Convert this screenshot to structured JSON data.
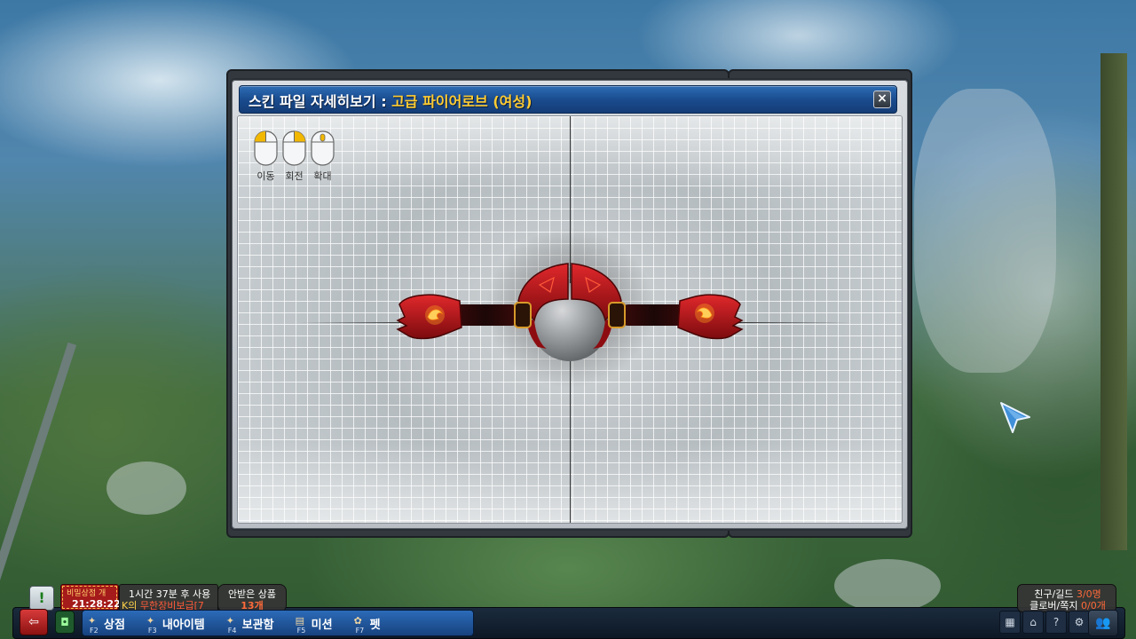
{
  "dialog": {
    "title_prefix": "스킨 파일 자세히보기 : ",
    "item_name": "고급 파이어로브 (여성)",
    "close_symbol": "×",
    "mouse_controls": [
      {
        "label": "이동",
        "button": "left"
      },
      {
        "label": "회전",
        "button": "right"
      },
      {
        "label": "확대",
        "button": "wheel"
      }
    ]
  },
  "hud": {
    "alert_symbol": "!",
    "notices": {
      "secret_shop": {
        "title": "비밀상점 개",
        "time": "21:28:22"
      },
      "buff": {
        "line1": "1시간 37분 후 사용",
        "line2_prefix": "K의 ",
        "line2_highlight": "무한장비보급[7"
      },
      "gifts": {
        "line1": "안받은 상품",
        "line2": "13개"
      }
    },
    "menu": [
      {
        "key": "F2",
        "label": "상점"
      },
      {
        "key": "F3",
        "label": "내아이템"
      },
      {
        "key": "F4",
        "label": "보관함"
      },
      {
        "key": "F5",
        "label": "미션"
      },
      {
        "key": "F7",
        "label": "펫"
      }
    ],
    "social": {
      "friend_label": "친구/길드 ",
      "friend_count": "3/0명",
      "closer_label": "클로버/쪽지 ",
      "closer_count": "0/0개"
    }
  },
  "colors": {
    "title_bar": "#1a4c8f",
    "item_name": "#ffcc33",
    "glove_red": "#c0161a",
    "glove_glow": "#ffb020"
  }
}
